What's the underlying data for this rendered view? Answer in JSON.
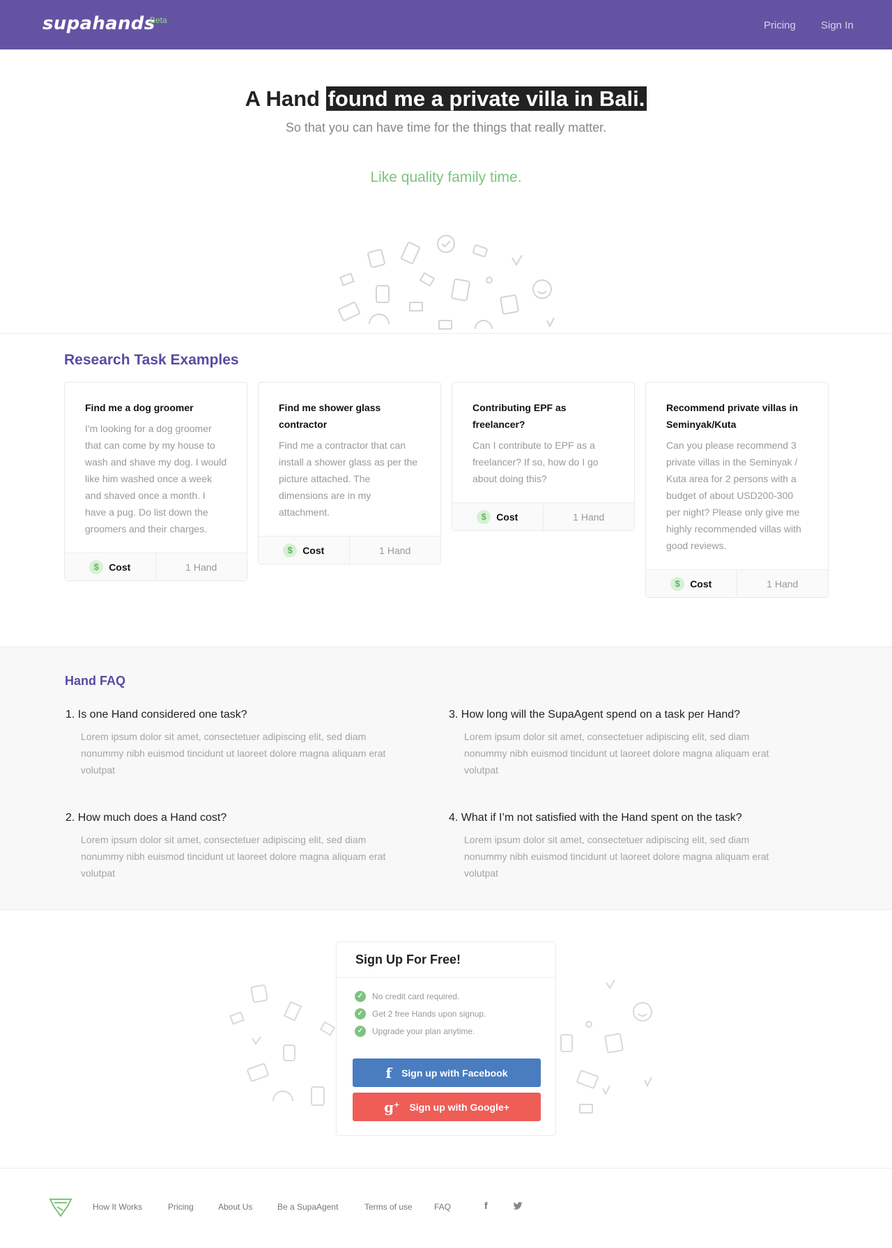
{
  "header": {
    "logo": "supahands",
    "beta": "Beta",
    "nav": {
      "pricing": "Pricing",
      "sign_in": "Sign In"
    }
  },
  "hero": {
    "title_prefix": "A Hand",
    "title_highlight": "found me a private villa in Bali.",
    "subtitle": "So that you can have time for the things that really matter.",
    "tagline": "Like quality family time."
  },
  "research": {
    "title": "Research Task Examples",
    "cards": [
      {
        "title": "Find me a dog groomer",
        "text": "I'm looking for a dog groomer that can come by my house to wash and shave my dog. I would like him washed once a week and shaved once a month. I have a pug. Do list down the groomers and their charges.",
        "cost_label": "Cost",
        "hand_label": "1 Hand",
        "coin": "$"
      },
      {
        "title": "Find me shower glass contractor",
        "text": "Find me a contractor that can install a shower glass as per the picture attached. The dimensions are in my attachment.",
        "cost_label": "Cost",
        "hand_label": "1 Hand",
        "coin": "$"
      },
      {
        "title": "Contributing EPF as freelancer?",
        "text": "Can I contribute to EPF as a freelancer? If so, how do I go about doing this?",
        "cost_label": "Cost",
        "hand_label": "1 Hand",
        "coin": "$"
      },
      {
        "title": "Recommend private villas in Seminyak/Kuta",
        "text": "Can you please recommend 3 private villas in the Seminyak / Kuta area for 2 persons with a budget of about USD200-300 per night? Please only give me highly recommended villas with good reviews.",
        "cost_label": "Cost",
        "hand_label": "1 Hand",
        "coin": "$"
      }
    ]
  },
  "faq": {
    "title": "Hand FAQ",
    "items": [
      {
        "q": "1. Is one Hand considered one task?",
        "a": "Lorem ipsum dolor sit amet, consectetuer adipiscing elit, sed diam nonummy nibh euismod tincidunt ut laoreet dolore magna aliquam erat volutpat"
      },
      {
        "q": "2. How much does a Hand cost?",
        "a": "Lorem ipsum dolor sit amet, consectetuer adipiscing elit, sed diam nonummy nibh euismod tincidunt ut laoreet dolore magna aliquam erat volutpat"
      },
      {
        "q": "3. How long will the SupaAgent spend on a task per Hand?",
        "a": "Lorem ipsum dolor sit amet, consectetuer adipiscing elit, sed diam nonummy nibh euismod tincidunt ut laoreet dolore magna aliquam erat volutpat"
      },
      {
        "q": "4. What if I’m not satisfied with the Hand spent on the task?",
        "a": "Lorem ipsum dolor sit amet, consectetuer adipiscing elit, sed diam nonummy nibh euismod tincidunt ut laoreet dolore magna aliquam erat volutpat"
      }
    ]
  },
  "signup": {
    "title": "Sign Up For Free!",
    "perks": [
      "No credit card required.",
      "Get 2 free Hands upon signup.",
      "Upgrade your plan anytime."
    ],
    "facebook_label": "Sign up with Facebook",
    "google_label": "Sign up with Google+"
  },
  "footer": {
    "links": [
      "How It Works",
      "Pricing",
      "About Us",
      "Be a SupaAgent",
      "Terms of use",
      "FAQ"
    ],
    "social": {
      "facebook": "f",
      "twitter": "twitter-icon"
    }
  },
  "colors": {
    "brand": "#6453a3",
    "accent_green": "#7cc47f",
    "facebook": "#4a7cc0",
    "google": "#ef5d57"
  }
}
